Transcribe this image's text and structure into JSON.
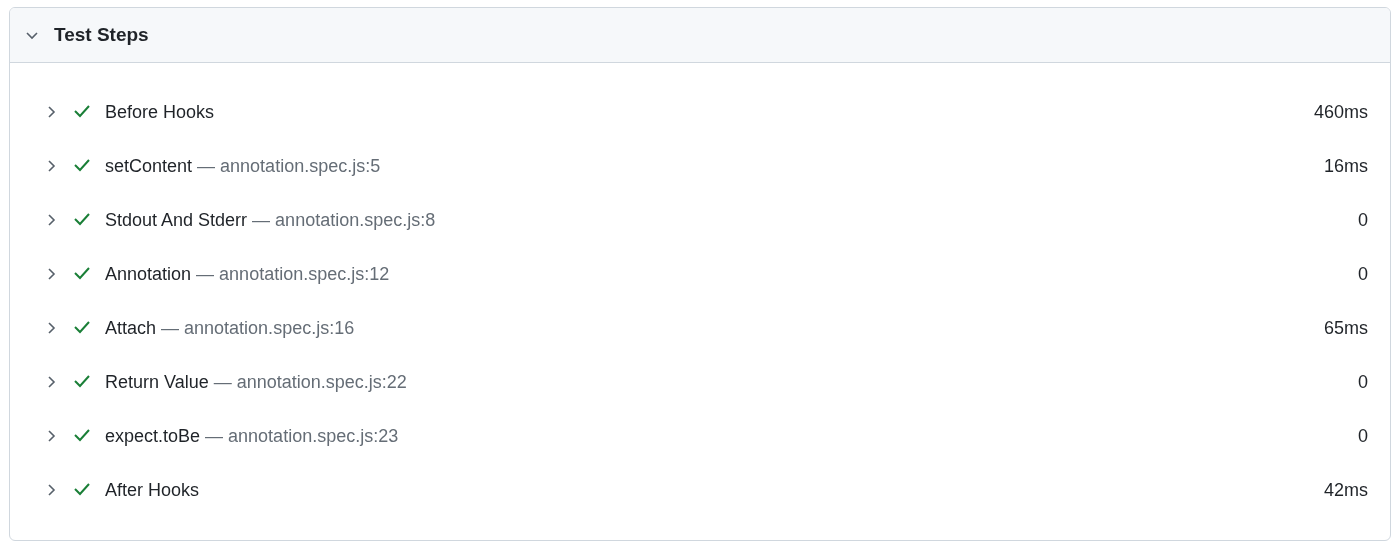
{
  "panel": {
    "title": "Test Steps",
    "expanded": true
  },
  "steps": [
    {
      "title": "Before Hooks",
      "expanded": false,
      "passed": true,
      "duration": "460ms"
    },
    {
      "title": "setContent",
      "location": "— annotation.spec.js:5",
      "expanded": false,
      "passed": true,
      "duration": "16ms"
    },
    {
      "title": "Stdout And Stderr",
      "location": "— annotation.spec.js:8",
      "expanded": false,
      "passed": true,
      "duration": "0"
    },
    {
      "title": "Annotation",
      "location": "— annotation.spec.js:12",
      "expanded": false,
      "passed": true,
      "duration": "0"
    },
    {
      "title": "Attach",
      "location": "— annotation.spec.js:16",
      "expanded": false,
      "passed": true,
      "duration": "65ms"
    },
    {
      "title": "Return Value",
      "location": "— annotation.spec.js:22",
      "expanded": false,
      "passed": true,
      "duration": "0"
    },
    {
      "title": "expect.toBe",
      "location": "— annotation.spec.js:23",
      "expanded": false,
      "passed": true,
      "duration": "0"
    },
    {
      "title": "After Hooks",
      "expanded": false,
      "passed": true,
      "duration": "42ms"
    }
  ]
}
